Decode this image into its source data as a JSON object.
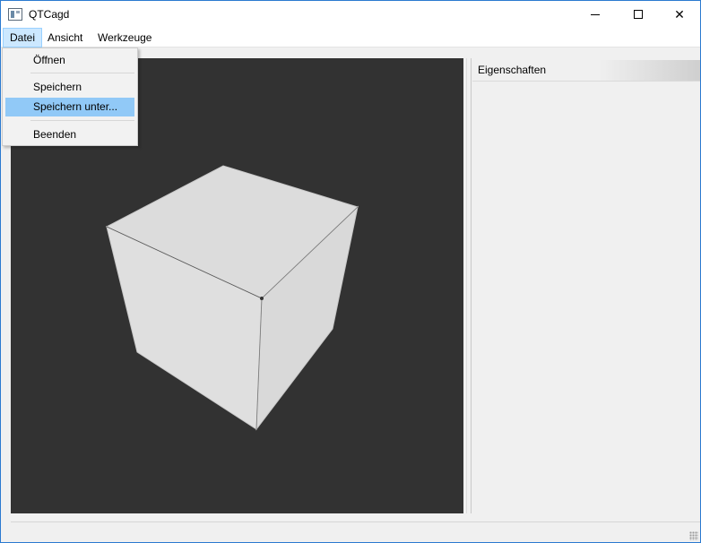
{
  "window": {
    "title": "QTCagd",
    "app_icon": "qt-window-icon",
    "controls": {
      "minimize": "minimize-icon",
      "maximize": "maximize-icon",
      "close": "close-icon",
      "close_glyph": "✕"
    }
  },
  "menubar": {
    "items": [
      "Datei",
      "Ansicht",
      "Werkzeuge"
    ],
    "open_menu": "Datei"
  },
  "file_menu": {
    "items": [
      {
        "label": "Öffnen"
      },
      {
        "label": "Speichern"
      },
      {
        "label": "Speichern unter...",
        "highlighted": true
      },
      {
        "label": "Beenden"
      }
    ]
  },
  "viewport": {
    "background": "#323232",
    "object": "cube",
    "face_colors": {
      "top": "#dcdcdc",
      "left": "#dfdfdf",
      "right": "#d9d9d9"
    }
  },
  "properties_panel": {
    "title": "Eigenschaften"
  },
  "colors": {
    "menu_highlight": "#91c9f7",
    "menubar_active": "#cce8ff",
    "window_border": "#2b7ad0"
  }
}
